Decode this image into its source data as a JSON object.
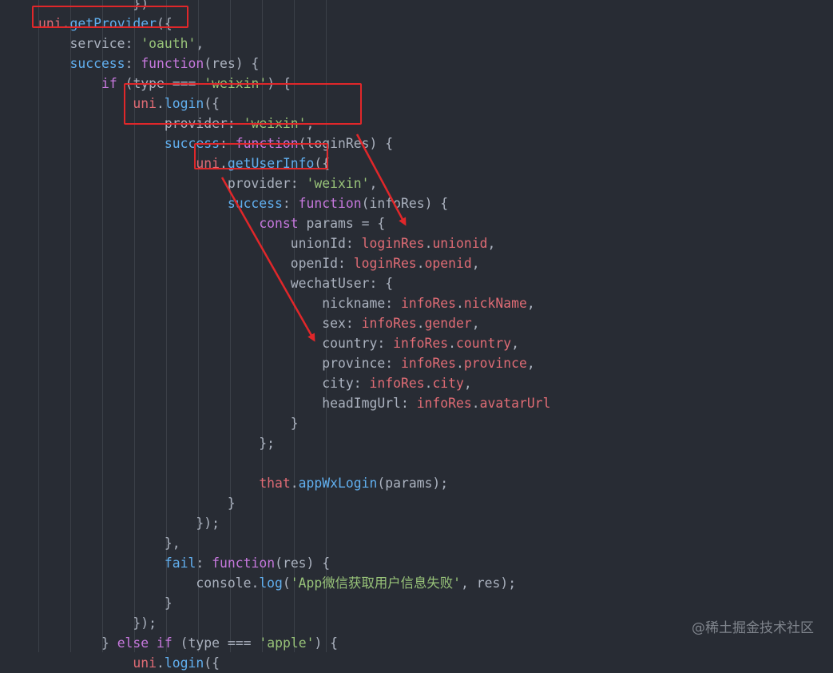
{
  "colors": {
    "background": "#282c34",
    "keyword": "#c678dd",
    "function": "#61afef",
    "string": "#98c379",
    "variable": "#e06c75",
    "text": "#abb2bf",
    "annotation": "#e0272a"
  },
  "code_lines": [
    [
      {
        "t": "            })",
        "c": "punc"
      }
    ],
    [
      {
        "t": "uni",
        "c": "var"
      },
      {
        "t": ".",
        "c": "punc"
      },
      {
        "t": "getProvider",
        "c": "fn"
      },
      {
        "t": "({",
        "c": "punc"
      }
    ],
    [
      {
        "t": "    service",
        "c": "prop"
      },
      {
        "t": ": ",
        "c": "punc"
      },
      {
        "t": "'oauth'",
        "c": "str"
      },
      {
        "t": ",",
        "c": "punc"
      }
    ],
    [
      {
        "t": "    success",
        "c": "fn"
      },
      {
        "t": ": ",
        "c": "punc"
      },
      {
        "t": "function",
        "c": "kw"
      },
      {
        "t": "(res) {",
        "c": "punc"
      }
    ],
    [
      {
        "t": "        ",
        "c": "plain"
      },
      {
        "t": "if",
        "c": "kw"
      },
      {
        "t": " (type === ",
        "c": "punc"
      },
      {
        "t": "'weixin'",
        "c": "str"
      },
      {
        "t": ") {",
        "c": "punc"
      }
    ],
    [
      {
        "t": "            ",
        "c": "plain"
      },
      {
        "t": "uni",
        "c": "var"
      },
      {
        "t": ".",
        "c": "punc"
      },
      {
        "t": "login",
        "c": "fn"
      },
      {
        "t": "({",
        "c": "punc"
      }
    ],
    [
      {
        "t": "                provider",
        "c": "prop"
      },
      {
        "t": ": ",
        "c": "punc"
      },
      {
        "t": "'weixin'",
        "c": "str"
      },
      {
        "t": ",",
        "c": "punc"
      }
    ],
    [
      {
        "t": "                success",
        "c": "fn"
      },
      {
        "t": ": ",
        "c": "punc"
      },
      {
        "t": "function",
        "c": "kw"
      },
      {
        "t": "(loginRes) {",
        "c": "punc"
      }
    ],
    [
      {
        "t": "                    ",
        "c": "plain"
      },
      {
        "t": "uni",
        "c": "var"
      },
      {
        "t": ".",
        "c": "punc"
      },
      {
        "t": "getUserInfo",
        "c": "fn"
      },
      {
        "t": "({",
        "c": "punc"
      }
    ],
    [
      {
        "t": "                        provider",
        "c": "prop"
      },
      {
        "t": ": ",
        "c": "punc"
      },
      {
        "t": "'weixin'",
        "c": "str"
      },
      {
        "t": ",",
        "c": "punc"
      }
    ],
    [
      {
        "t": "                        success",
        "c": "fn"
      },
      {
        "t": ": ",
        "c": "punc"
      },
      {
        "t": "function",
        "c": "kw"
      },
      {
        "t": "(infoRes) {",
        "c": "punc"
      }
    ],
    [
      {
        "t": "                            ",
        "c": "plain"
      },
      {
        "t": "const",
        "c": "kw"
      },
      {
        "t": " params = {",
        "c": "punc"
      }
    ],
    [
      {
        "t": "                                unionId",
        "c": "prop"
      },
      {
        "t": ": ",
        "c": "punc"
      },
      {
        "t": "loginRes",
        "c": "var"
      },
      {
        "t": ".",
        "c": "punc"
      },
      {
        "t": "unionid",
        "c": "var"
      },
      {
        "t": ",",
        "c": "punc"
      }
    ],
    [
      {
        "t": "                                openId",
        "c": "prop"
      },
      {
        "t": ": ",
        "c": "punc"
      },
      {
        "t": "loginRes",
        "c": "var"
      },
      {
        "t": ".",
        "c": "punc"
      },
      {
        "t": "openid",
        "c": "var"
      },
      {
        "t": ",",
        "c": "punc"
      }
    ],
    [
      {
        "t": "                                wechatUser",
        "c": "prop"
      },
      {
        "t": ": {",
        "c": "punc"
      }
    ],
    [
      {
        "t": "                                    nickname",
        "c": "prop"
      },
      {
        "t": ": ",
        "c": "punc"
      },
      {
        "t": "infoRes",
        "c": "var"
      },
      {
        "t": ".",
        "c": "punc"
      },
      {
        "t": "nickName",
        "c": "var"
      },
      {
        "t": ",",
        "c": "punc"
      }
    ],
    [
      {
        "t": "                                    sex",
        "c": "prop"
      },
      {
        "t": ": ",
        "c": "punc"
      },
      {
        "t": "infoRes",
        "c": "var"
      },
      {
        "t": ".",
        "c": "punc"
      },
      {
        "t": "gender",
        "c": "var"
      },
      {
        "t": ",",
        "c": "punc"
      }
    ],
    [
      {
        "t": "                                    country",
        "c": "prop"
      },
      {
        "t": ": ",
        "c": "punc"
      },
      {
        "t": "infoRes",
        "c": "var"
      },
      {
        "t": ".",
        "c": "punc"
      },
      {
        "t": "country",
        "c": "var"
      },
      {
        "t": ",",
        "c": "punc"
      }
    ],
    [
      {
        "t": "                                    province",
        "c": "prop"
      },
      {
        "t": ": ",
        "c": "punc"
      },
      {
        "t": "infoRes",
        "c": "var"
      },
      {
        "t": ".",
        "c": "punc"
      },
      {
        "t": "province",
        "c": "var"
      },
      {
        "t": ",",
        "c": "punc"
      }
    ],
    [
      {
        "t": "                                    city",
        "c": "prop"
      },
      {
        "t": ": ",
        "c": "punc"
      },
      {
        "t": "infoRes",
        "c": "var"
      },
      {
        "t": ".",
        "c": "punc"
      },
      {
        "t": "city",
        "c": "var"
      },
      {
        "t": ",",
        "c": "punc"
      }
    ],
    [
      {
        "t": "                                    headImgUrl",
        "c": "prop"
      },
      {
        "t": ": ",
        "c": "punc"
      },
      {
        "t": "infoRes",
        "c": "var"
      },
      {
        "t": ".",
        "c": "punc"
      },
      {
        "t": "avatarUrl",
        "c": "var"
      }
    ],
    [
      {
        "t": "                                }",
        "c": "punc"
      }
    ],
    [
      {
        "t": "                            };",
        "c": "punc"
      }
    ],
    [
      {
        "t": "",
        "c": "plain"
      }
    ],
    [
      {
        "t": "                            ",
        "c": "plain"
      },
      {
        "t": "that",
        "c": "var"
      },
      {
        "t": ".",
        "c": "punc"
      },
      {
        "t": "appWxLogin",
        "c": "fn"
      },
      {
        "t": "(params);",
        "c": "punc"
      }
    ],
    [
      {
        "t": "                        }",
        "c": "punc"
      }
    ],
    [
      {
        "t": "                    });",
        "c": "punc"
      }
    ],
    [
      {
        "t": "                },",
        "c": "punc"
      }
    ],
    [
      {
        "t": "                fail",
        "c": "fn"
      },
      {
        "t": ": ",
        "c": "punc"
      },
      {
        "t": "function",
        "c": "kw"
      },
      {
        "t": "(res) {",
        "c": "punc"
      }
    ],
    [
      {
        "t": "                    console",
        "c": "prop"
      },
      {
        "t": ".",
        "c": "punc"
      },
      {
        "t": "log",
        "c": "fn"
      },
      {
        "t": "(",
        "c": "punc"
      },
      {
        "t": "'App微信获取用户信息失败'",
        "c": "str"
      },
      {
        "t": ", res);",
        "c": "punc"
      }
    ],
    [
      {
        "t": "                }",
        "c": "punc"
      }
    ],
    [
      {
        "t": "            });",
        "c": "punc"
      }
    ],
    [
      {
        "t": "        } ",
        "c": "punc"
      },
      {
        "t": "else",
        "c": "kw"
      },
      {
        "t": " ",
        "c": "plain"
      },
      {
        "t": "if",
        "c": "kw"
      },
      {
        "t": " (type === ",
        "c": "punc"
      },
      {
        "t": "'apple'",
        "c": "str"
      },
      {
        "t": ") {",
        "c": "punc"
      }
    ],
    [
      {
        "t": "            ",
        "c": "plain"
      },
      {
        "t": "uni",
        "c": "var"
      },
      {
        "t": ".",
        "c": "punc"
      },
      {
        "t": "login",
        "c": "fn"
      },
      {
        "t": "({",
        "c": "punc"
      }
    ]
  ],
  "watermark": "@稀土掘金技术社区"
}
